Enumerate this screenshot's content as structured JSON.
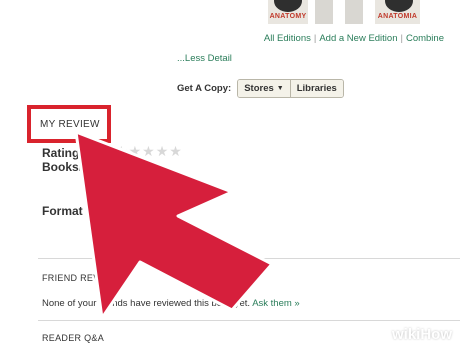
{
  "covers": [
    {
      "title": "ANATOMY"
    },
    {
      "title": ""
    },
    {
      "title": ""
    },
    {
      "title": "ANATOMIA"
    }
  ],
  "editions": {
    "all": "All Editions",
    "add": "Add a New Edition",
    "combine": "Combine",
    "separator": "|"
  },
  "less_detail": "...Less Detail",
  "get_copy": {
    "label": "Get A Copy:",
    "stores": "Stores",
    "libraries": "Libraries"
  },
  "my_review": {
    "heading": "MY REVIEW",
    "rating_label": "Rating",
    "bookshelves_label": "Bookshe",
    "format_label": "Format",
    "rating_value": 0,
    "star_count": 5
  },
  "friend_reviews": {
    "heading": "FRIEND REVIEWS",
    "text": "None of your friends have reviewed this book yet.",
    "ask": "Ask them »"
  },
  "reader_qa": {
    "heading": "READER Q&A"
  },
  "colors": {
    "link": "#2a7d5a",
    "highlight": "#d9232d",
    "arrow": "#d61f3c"
  },
  "watermark": {
    "text": "wikiHow"
  }
}
